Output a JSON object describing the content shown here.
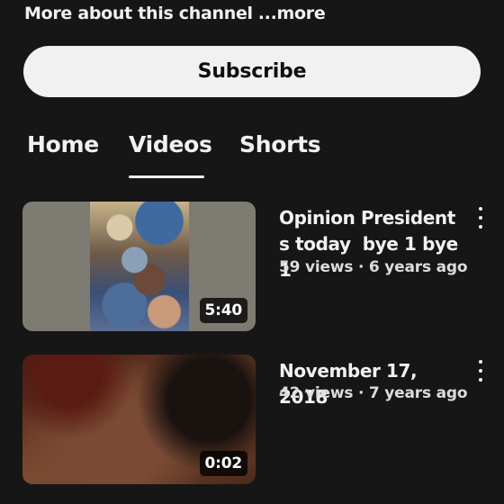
{
  "channel": {
    "about_text": "More about this channel",
    "more_link": "...more"
  },
  "subscribe": {
    "label": "Subscribe"
  },
  "tabs": [
    {
      "label": "Home",
      "selected": false
    },
    {
      "label": "Videos",
      "selected": true
    },
    {
      "label": "Shorts",
      "selected": false
    }
  ],
  "videos": [
    {
      "title": "Opinion President\ns today  bye 1 bye 1",
      "views": "59 views",
      "age": "6 years ago",
      "meta": "59 views · 6 years ago",
      "duration": "5:40",
      "menu_icon": "more-vertical-icon"
    },
    {
      "title": "November 17, 2018",
      "views": "42 views",
      "age": "7 years ago",
      "meta": "42 views · 7 years ago",
      "duration": "0:02",
      "menu_icon": "more-vertical-icon"
    }
  ],
  "colors": {
    "background": "#161616",
    "text": "#f1f1f1",
    "subscribe_bg": "#f1f1f1"
  }
}
